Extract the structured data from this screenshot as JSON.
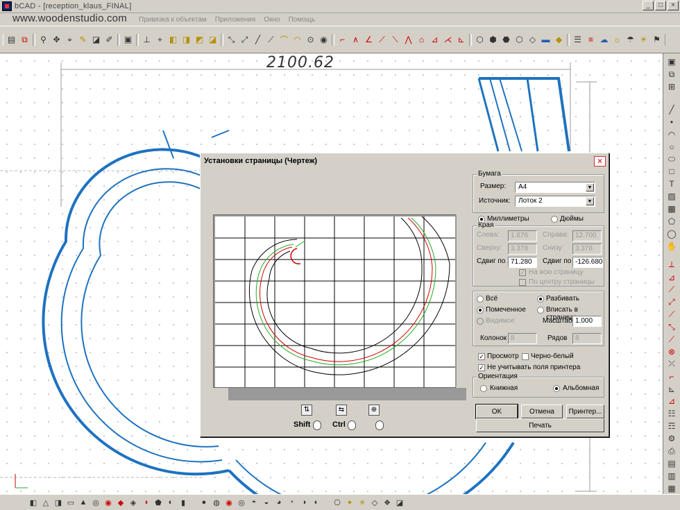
{
  "window": {
    "title": "bCAD - [reception_klaus_FINAL]"
  },
  "watermark": "www.woodenstudio.com",
  "menu": [
    "Привязка к объектам",
    "Приложения",
    "Окно",
    "Помощь"
  ],
  "canvas": {
    "dimension_label": "2100.62"
  },
  "dialog": {
    "title": "Установки страницы (Чертеж)",
    "paper": {
      "group_title": "Бумага",
      "size_label": "Размер:",
      "size_value": "A4",
      "source_label": "Источник:",
      "source_value": "Лоток 2"
    },
    "units": {
      "mm": "Миллиметры",
      "inch": "Дюймы"
    },
    "margins": {
      "group_title": "Края",
      "left_label": "Слева:",
      "left_value": "1.676",
      "right_label": "Справа:",
      "right_value": "12.700",
      "top_label": "Сверху:",
      "top_value": "3.378",
      "bottom_label": "Снизу:",
      "bottom_value": "3.378",
      "shift_x_label": "Сдвиг по X",
      "shift_x_value": "71.280",
      "shift_y_label": "Сдвиг по Y",
      "shift_y_value": "-126.680",
      "whole_page": "На всю страницу",
      "center_page": "По центру страницы"
    },
    "scope": {
      "all": "Всё",
      "split": "Разбивать",
      "marked": "Помеченное",
      "fit": "Вписать в страницу",
      "visible": "Видимое",
      "scale_label": "Масштаб",
      "scale_value": "1.000",
      "cols_label": "Колонок",
      "cols_value": "8",
      "rows_label": "Рядов",
      "rows_value": "8"
    },
    "preview_chk": "Просмотр",
    "bw_chk": "Черно-белый",
    "ignore_margins_chk": "Не учитывать поля принтера",
    "orientation": {
      "group_title": "Ориентация",
      "portrait": "Книжная",
      "landscape": "Альбомная"
    },
    "buttons": {
      "ok": "OK",
      "cancel": "Отмена",
      "printer": "Принтер...",
      "print": "Печать"
    },
    "keys": {
      "shift": "Shift",
      "ctrl": "Ctrl"
    }
  }
}
